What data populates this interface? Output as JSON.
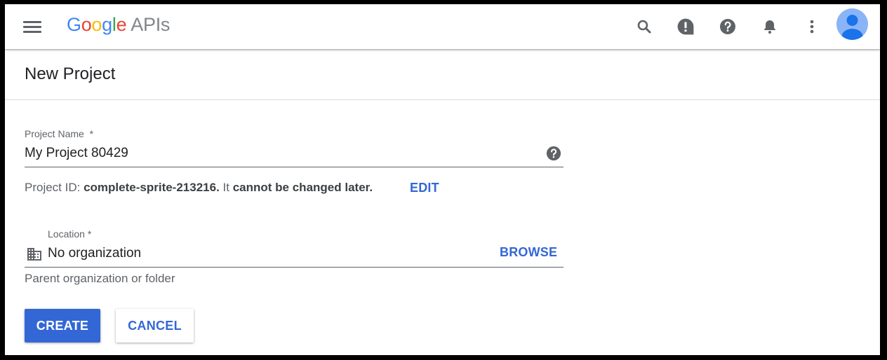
{
  "app": {
    "logo_letters": [
      {
        "char": "G",
        "color": "#4285F4"
      },
      {
        "char": "o",
        "color": "#EA4335"
      },
      {
        "char": "o",
        "color": "#FBBC05"
      },
      {
        "char": "g",
        "color": "#4285F4"
      },
      {
        "char": "l",
        "color": "#34A853"
      },
      {
        "char": "e",
        "color": "#EA4335"
      }
    ],
    "logo_suffix": "APIs"
  },
  "topbar": {
    "icons": [
      "menu-icon",
      "search-icon",
      "feedback-icon",
      "help-icon",
      "notifications-icon",
      "more-vert-icon",
      "account-avatar"
    ]
  },
  "page": {
    "title": "New Project"
  },
  "form": {
    "project_name": {
      "label": "Project Name",
      "required_mark": "*",
      "value": "My Project 80429"
    },
    "project_id": {
      "prefix": "Project ID:",
      "id": "complete-sprite-213216",
      "period": ".",
      "mid": " It",
      "emph": "cannot be changed later.",
      "edit_label": "EDIT"
    },
    "location": {
      "label": "Location *",
      "value": "No organization",
      "browse_label": "BROWSE",
      "hint": "Parent organization or folder"
    }
  },
  "actions": {
    "create_label": "CREATE",
    "cancel_label": "CANCEL"
  },
  "colors": {
    "accent": "#3367d6",
    "icon_gray": "#5f6368",
    "avatar_bg": "#8ab4f8",
    "avatar_fg": "#1a73e8"
  }
}
